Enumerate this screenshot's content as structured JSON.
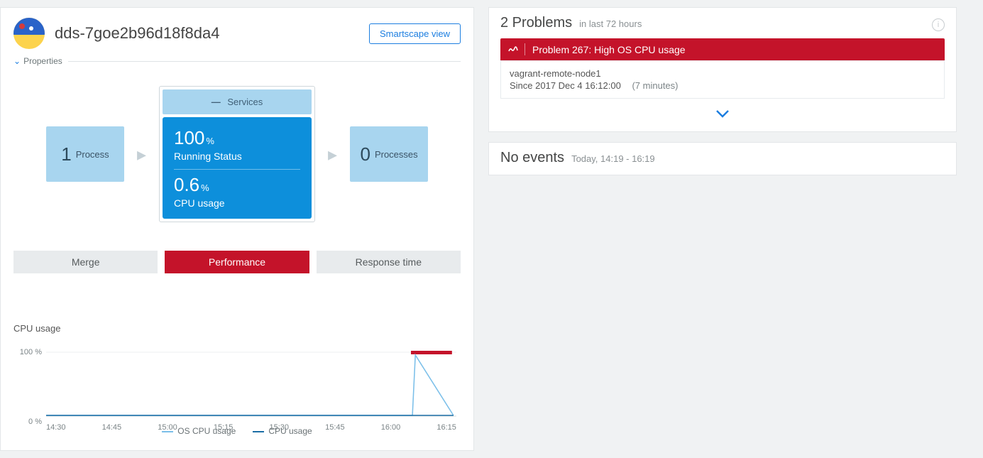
{
  "header": {
    "title": "dds-7goe2b96d18f8da4",
    "smartscape_label": "Smartscape view",
    "properties_label": "Properties"
  },
  "topology": {
    "left": {
      "count": "1",
      "label": "Process"
    },
    "services_label": "Services",
    "main": {
      "metric1_value": "100",
      "metric1_unit": "%",
      "metric1_label": "Running Status",
      "metric2_value": "0.6",
      "metric2_unit": "%",
      "metric2_label": "CPU usage"
    },
    "right": {
      "count": "0",
      "label": "Processes"
    }
  },
  "tabs": [
    "Merge",
    "Performance",
    "Response time"
  ],
  "active_tab": 1,
  "chart": {
    "title": "CPU usage",
    "y_top": "100 %",
    "y_bottom": "0 %",
    "legend": [
      "OS CPU usage",
      "CPU usage"
    ],
    "colors": {
      "os": "#7bbfe9",
      "cpu": "#1b6ea5"
    }
  },
  "chart_data": {
    "type": "line",
    "x": [
      "14:30",
      "14:45",
      "15:00",
      "15:15",
      "15:30",
      "15:45",
      "16:00",
      "16:15"
    ],
    "ylabel": "%",
    "ylim": [
      0,
      100
    ],
    "series": [
      {
        "name": "OS CPU usage",
        "values": [
          1,
          1,
          1,
          1,
          1,
          1,
          1,
          1,
          3
        ]
      },
      {
        "name": "CPU usage",
        "values": [
          1,
          1,
          1,
          1,
          1,
          1,
          1,
          1,
          2
        ]
      }
    ],
    "anomaly_band": {
      "start": "16:10",
      "end": "16:20",
      "value": 100
    }
  },
  "problems": {
    "title": "2 Problems",
    "subtitle": "in last 72 hours",
    "item": {
      "header": "Problem 267: High OS CPU usage",
      "host": "vagrant-remote-node1",
      "since_label": "Since 2017 Dec 4 16:12:00",
      "duration": "(7 minutes)"
    }
  },
  "events": {
    "title": "No events",
    "subtitle": "Today, 14:19 - 16:19"
  }
}
